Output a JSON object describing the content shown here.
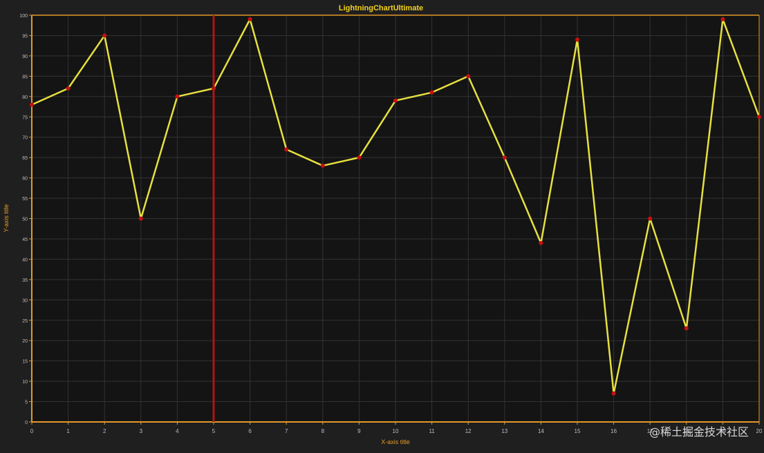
{
  "chart_data": {
    "type": "line",
    "title": "LightningChartUltimate",
    "xlabel": "X-axis title",
    "ylabel": "Y-axis title",
    "xlim": [
      0,
      20
    ],
    "ylim": [
      0,
      100
    ],
    "x_ticks": [
      0,
      1,
      2,
      3,
      4,
      5,
      6,
      7,
      8,
      9,
      10,
      11,
      12,
      13,
      14,
      15,
      16,
      17,
      18,
      19,
      20
    ],
    "y_ticks": [
      0,
      5,
      10,
      15,
      20,
      25,
      30,
      35,
      40,
      45,
      50,
      55,
      60,
      65,
      70,
      75,
      80,
      85,
      90,
      95,
      100
    ],
    "grid": true,
    "series": [
      {
        "x": [
          0,
          1,
          2,
          3,
          4,
          5,
          6,
          7,
          8,
          9,
          10,
          11,
          12,
          13,
          14,
          15,
          16,
          17,
          18,
          19,
          20
        ],
        "values": [
          78,
          82,
          95,
          50,
          80,
          82,
          99,
          67,
          63,
          65,
          79,
          81,
          85,
          65,
          44,
          94,
          7,
          50,
          23,
          99,
          75
        ]
      }
    ],
    "cursor_x": 5,
    "colors": {
      "background": "#1f1f1f",
      "plot_background": "#141414",
      "grid": "#333333",
      "axis": "#e39a28",
      "title": "#f5d31c",
      "tick_label": "#bfbfbf",
      "line": "#e6e040",
      "marker": "#c81010",
      "cursor": "#b01515"
    }
  },
  "watermark": "@稀土掘金技术社区"
}
